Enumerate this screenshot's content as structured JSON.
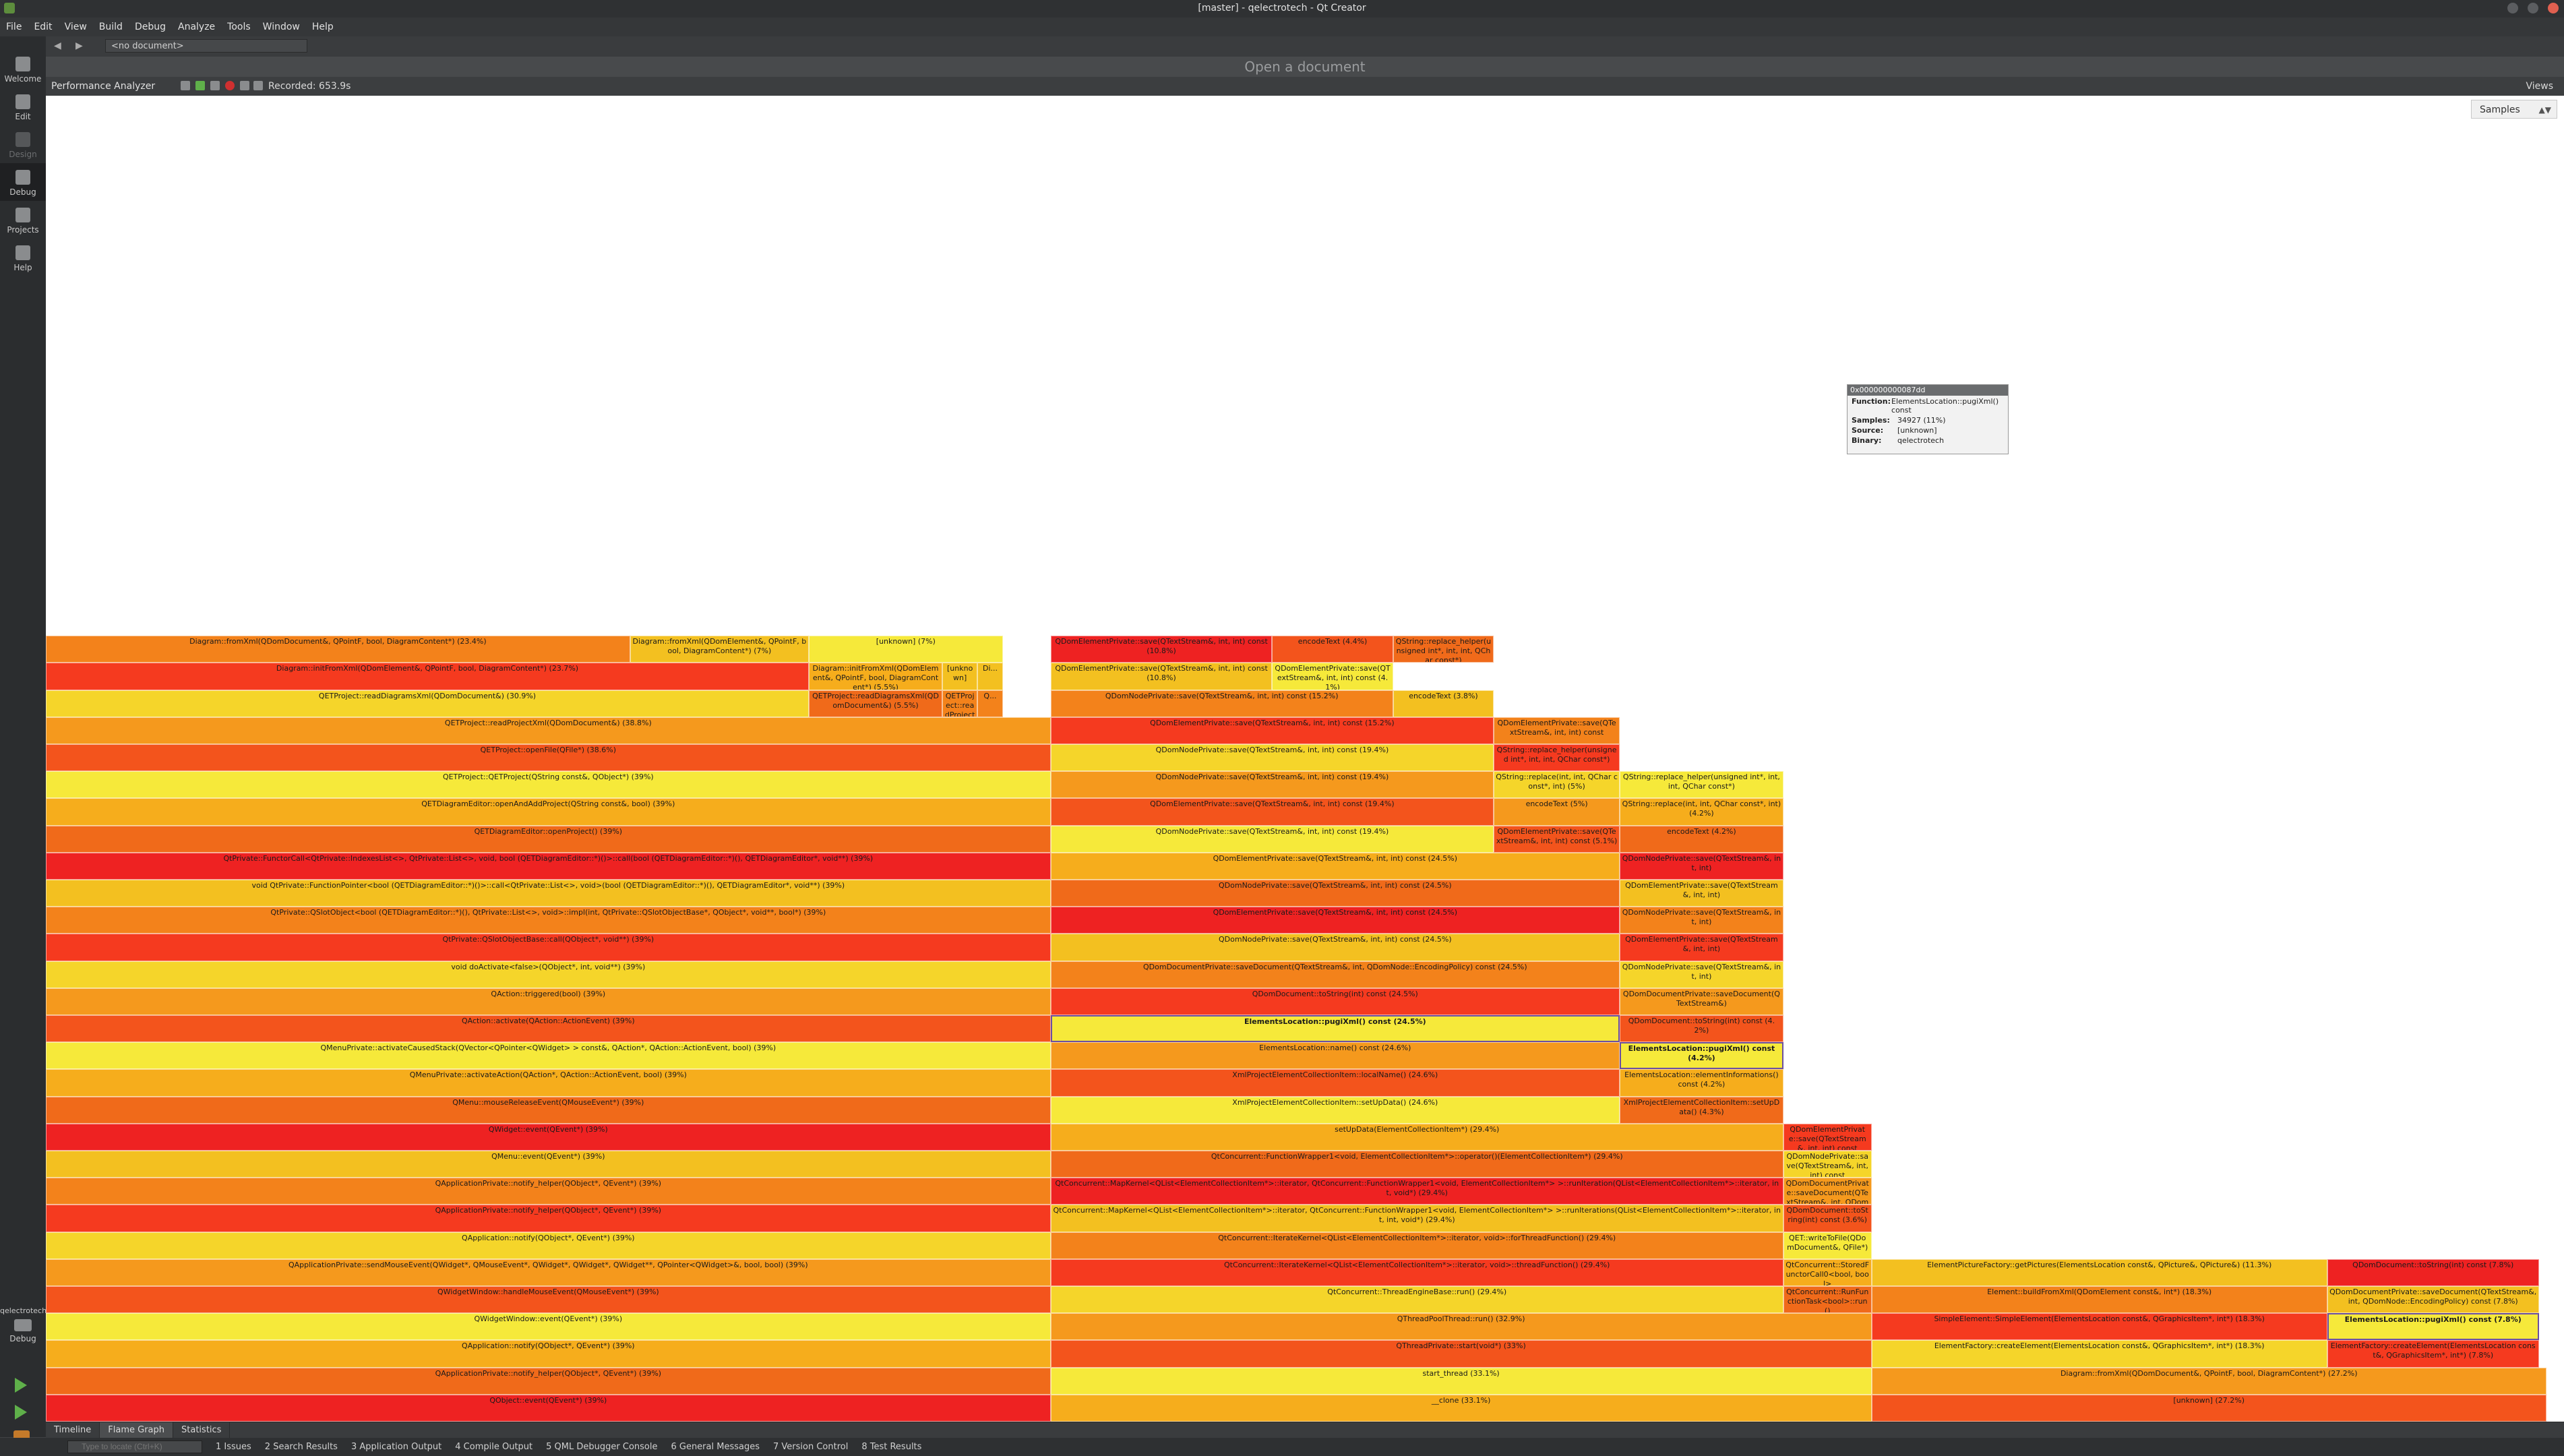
{
  "window": {
    "title": "[master] - qelectrotech - Qt Creator"
  },
  "menu": [
    "File",
    "Edit",
    "View",
    "Build",
    "Debug",
    "Analyze",
    "Tools",
    "Window",
    "Help"
  ],
  "modes": [
    {
      "label": "Welcome",
      "icon": "grid-icon"
    },
    {
      "label": "Edit",
      "icon": "document-icon"
    },
    {
      "label": "Design",
      "icon": "pen-icon"
    },
    {
      "label": "Debug",
      "icon": "bug-icon"
    },
    {
      "label": "Projects",
      "icon": "wrench-icon"
    },
    {
      "label": "Help",
      "icon": "question-icon"
    }
  ],
  "kit": {
    "label": "qelectrotech",
    "sub": "Debug"
  },
  "editor": {
    "doc_select": "<no document>",
    "open_doc": "Open a document"
  },
  "analyzer": {
    "label": "Performance Analyzer",
    "recorded": "Recorded: 653.9s",
    "views": "Views"
  },
  "sort": {
    "value": "Samples"
  },
  "tooltip": {
    "header": "0x000000000087dd",
    "rows": [
      {
        "k": "Function:",
        "v": "ElementsLocation::pugiXml() const"
      },
      {
        "k": "Samples:",
        "v": "34927 (11%)"
      },
      {
        "k": "Source:",
        "v": "[unknown]"
      },
      {
        "k": "Binary:",
        "v": "qelectrotech"
      }
    ]
  },
  "flame": [
    {
      "c": 0,
      "s": 0,
      "e": 0.399,
      "t": "QObject::event(QEvent*) (39%)"
    },
    {
      "c": 0,
      "s": 0.399,
      "e": 0.725,
      "t": "__clone (33.1%)"
    },
    {
      "c": 0,
      "s": 0.725,
      "e": 0.993,
      "t": "[unknown] (27.2%)"
    },
    {
      "c": 1,
      "s": 0,
      "e": 0.399,
      "t": "QApplicationPrivate::notify_helper(QObject*, QEvent*) (39%)"
    },
    {
      "c": 1,
      "s": 0.399,
      "e": 0.725,
      "t": "start_thread (33.1%)"
    },
    {
      "c": 1,
      "s": 0.725,
      "e": 0.993,
      "t": "Diagram::fromXml(QDomDocument&, QPointF, bool, DiagramContent*) (27.2%)"
    },
    {
      "c": 2,
      "s": 0,
      "e": 0.399,
      "t": "QApplication::notify(QObject*, QEvent*) (39%)"
    },
    {
      "c": 2,
      "s": 0.399,
      "e": 0.725,
      "t": "QThreadPrivate::start(void*) (33%)"
    },
    {
      "c": 2,
      "s": 0.725,
      "e": 0.906,
      "t": "ElementFactory::createElement(ElementsLocation const&, QGraphicsItem*, int*) (18.3%)"
    },
    {
      "c": 2,
      "s": 0.906,
      "e": 0.99,
      "t": "ElementFactory::createElement(ElementsLocation const&, QGraphicsItem*, int*) (7.8%)"
    },
    {
      "c": 3,
      "s": 0,
      "e": 0.399,
      "t": "QWidgetWindow::event(QEvent*) (39%)"
    },
    {
      "c": 3,
      "s": 0.399,
      "e": 0.725,
      "t": "QThreadPoolThread::run() (32.9%)"
    },
    {
      "c": 3,
      "s": 0.725,
      "e": 0.906,
      "t": "SimpleElement::SimpleElement(ElementsLocation const&, QGraphicsItem*, int*) (18.3%)"
    },
    {
      "c": 3,
      "s": 0.906,
      "e": 0.99,
      "t": "ElementsLocation::pugiXml() const (7.8%)",
      "hi": 1
    },
    {
      "c": 4,
      "s": 0,
      "e": 0.399,
      "t": "QWidgetWindow::handleMouseEvent(QMouseEvent*) (39%)"
    },
    {
      "c": 4,
      "s": 0.399,
      "e": 0.69,
      "t": "QtConcurrent::ThreadEngineBase::run() (29.4%)"
    },
    {
      "c": 4,
      "s": 0.69,
      "e": 0.725,
      "t": "QtConcurrent::RunFunctionTask<bool>::run()"
    },
    {
      "c": 4,
      "s": 0.725,
      "e": 0.906,
      "t": "Element::buildFromXml(QDomElement const&, int*) (18.3%)"
    },
    {
      "c": 4,
      "s": 0.906,
      "e": 0.99,
      "t": "QDomDocumentPrivate::saveDocument(QTextStream&, int, QDomNode::EncodingPolicy) const (7.8%)"
    },
    {
      "c": 5,
      "s": 0,
      "e": 0.399,
      "t": "QApplicationPrivate::sendMouseEvent(QWidget*, QMouseEvent*, QWidget*, QWidget*, QWidget**, QPointer<QWidget>&, bool, bool) (39%)"
    },
    {
      "c": 5,
      "s": 0.399,
      "e": 0.69,
      "t": "QtConcurrent::IterateKernel<QList<ElementCollectionItem*>::iterator, void>::threadFunction() (29.4%)"
    },
    {
      "c": 5,
      "s": 0.69,
      "e": 0.725,
      "t": "QtConcurrent::StoredFunctorCall0<bool, bool>"
    },
    {
      "c": 5,
      "s": 0.725,
      "e": 0.906,
      "t": "ElementPictureFactory::getPictures(ElementsLocation const&, QPicture&, QPicture&) (11.3%)"
    },
    {
      "c": 5,
      "s": 0.906,
      "e": 0.99,
      "t": "QDomDocument::toString(int) const (7.8%)"
    },
    {
      "c": 6,
      "s": 0,
      "e": 0.399,
      "t": "QApplication::notify(QObject*, QEvent*) (39%)"
    },
    {
      "c": 6,
      "s": 0.399,
      "e": 0.69,
      "t": "QtConcurrent::IterateKernel<QList<ElementCollectionItem*>::iterator, void>::forThreadFunction() (29.4%)"
    },
    {
      "c": 6,
      "s": 0.69,
      "e": 0.725,
      "t": "QET::writeToFile(QDomDocument&, QFile*)"
    },
    {
      "c": 7,
      "s": 0,
      "e": 0.399,
      "t": "QApplicationPrivate::notify_helper(QObject*, QEvent*) (39%)"
    },
    {
      "c": 7,
      "s": 0.399,
      "e": 0.69,
      "t": "QtConcurrent::MapKernel<QList<ElementCollectionItem*>::iterator, QtConcurrent::FunctionWrapper1<void, ElementCollectionItem*> >::runIterations(QList<ElementCollectionItem*>::iterator, int, int, void*) (29.4%)"
    },
    {
      "c": 7,
      "s": 0.69,
      "e": 0.725,
      "t": "QDomDocument::toString(int) const (3.6%)"
    },
    {
      "c": 8,
      "s": 0,
      "e": 0.399,
      "t": "QApplicationPrivate::notify_helper(QObject*, QEvent*) (39%)"
    },
    {
      "c": 8,
      "s": 0.399,
      "e": 0.69,
      "t": "QtConcurrent::MapKernel<QList<ElementCollectionItem*>::iterator, QtConcurrent::FunctionWrapper1<void, ElementCollectionItem*> >::runIteration(QList<ElementCollectionItem*>::iterator, int, void*) (29.4%)"
    },
    {
      "c": 8,
      "s": 0.69,
      "e": 0.725,
      "t": "QDomDocumentPrivate::saveDocument(QTextStream&, int, QDomNode)"
    },
    {
      "c": 9,
      "s": 0,
      "e": 0.399,
      "t": "QMenu::event(QEvent*) (39%)"
    },
    {
      "c": 9,
      "s": 0.399,
      "e": 0.69,
      "t": "QtConcurrent::FunctionWrapper1<void, ElementCollectionItem*>::operator()(ElementCollectionItem*) (29.4%)"
    },
    {
      "c": 9,
      "s": 0.69,
      "e": 0.725,
      "t": "QDomNodePrivate::save(QTextStream&, int, int) const"
    },
    {
      "c": 10,
      "s": 0,
      "e": 0.399,
      "t": "QWidget::event(QEvent*) (39%)"
    },
    {
      "c": 10,
      "s": 0.399,
      "e": 0.69,
      "t": "setUpData(ElementCollectionItem*) (29.4%)"
    },
    {
      "c": 10,
      "s": 0.69,
      "e": 0.725,
      "t": "QDomElementPrivate::save(QTextStream&, int, int) const"
    },
    {
      "c": 11,
      "s": 0,
      "e": 0.399,
      "t": "QMenu::mouseReleaseEvent(QMouseEvent*) (39%)"
    },
    {
      "c": 11,
      "s": 0.399,
      "e": 0.625,
      "t": "XmlProjectElementCollectionItem::setUpData() (24.6%)"
    },
    {
      "c": 11,
      "s": 0.625,
      "e": 0.69,
      "t": "XmlProjectElementCollectionItem::setUpData() (4.3%)"
    },
    {
      "c": 12,
      "s": 0,
      "e": 0.399,
      "t": "QMenuPrivate::activateAction(QAction*, QAction::ActionEvent, bool) (39%)"
    },
    {
      "c": 12,
      "s": 0.399,
      "e": 0.625,
      "t": "XmlProjectElementCollectionItem::localName() (24.6%)"
    },
    {
      "c": 12,
      "s": 0.625,
      "e": 0.69,
      "t": "ElementsLocation::elementInformations() const (4.2%)"
    },
    {
      "c": 13,
      "s": 0,
      "e": 0.399,
      "t": "QMenuPrivate::activateCausedStack(QVector<QPointer<QWidget> > const&, QAction*, QAction::ActionEvent, bool) (39%)"
    },
    {
      "c": 13,
      "s": 0.399,
      "e": 0.625,
      "t": "ElementsLocation::name() const (24.6%)"
    },
    {
      "c": 13,
      "s": 0.625,
      "e": 0.69,
      "t": "ElementsLocation::pugiXml() const (4.2%)",
      "hi": 1
    },
    {
      "c": 14,
      "s": 0,
      "e": 0.399,
      "t": "QAction::activate(QAction::ActionEvent) (39%)"
    },
    {
      "c": 14,
      "s": 0.399,
      "e": 0.625,
      "t": "ElementsLocation::pugiXml() const (24.5%)",
      "hi": 1
    },
    {
      "c": 14,
      "s": 0.625,
      "e": 0.69,
      "t": "QDomDocument::toString(int) const (4.2%)"
    },
    {
      "c": 15,
      "s": 0,
      "e": 0.399,
      "t": "QAction::triggered(bool) (39%)"
    },
    {
      "c": 15,
      "s": 0.399,
      "e": 0.625,
      "t": "QDomDocument::toString(int) const (24.5%)"
    },
    {
      "c": 15,
      "s": 0.625,
      "e": 0.69,
      "t": "QDomDocumentPrivate::saveDocument(QTextStream&)"
    },
    {
      "c": 16,
      "s": 0,
      "e": 0.399,
      "t": "void doActivate<false>(QObject*, int, void**) (39%)"
    },
    {
      "c": 16,
      "s": 0.399,
      "e": 0.625,
      "t": "QDomDocumentPrivate::saveDocument(QTextStream&, int, QDomNode::EncodingPolicy) const (24.5%)"
    },
    {
      "c": 16,
      "s": 0.625,
      "e": 0.69,
      "t": "QDomNodePrivate::save(QTextStream&, int, int)"
    },
    {
      "c": 17,
      "s": 0,
      "e": 0.399,
      "t": "QtPrivate::QSlotObjectBase::call(QObject*, void**) (39%)"
    },
    {
      "c": 17,
      "s": 0.399,
      "e": 0.625,
      "t": "QDomNodePrivate::save(QTextStream&, int, int) const (24.5%)"
    },
    {
      "c": 17,
      "s": 0.625,
      "e": 0.69,
      "t": "QDomElementPrivate::save(QTextStream&, int, int)"
    },
    {
      "c": 18,
      "s": 0,
      "e": 0.399,
      "t": "QtPrivate::QSlotObject<bool (QETDiagramEditor::*)(), QtPrivate::List<>, void>::impl(int, QtPrivate::QSlotObjectBase*, QObject*, void**, bool*) (39%)"
    },
    {
      "c": 18,
      "s": 0.399,
      "e": 0.625,
      "t": "QDomElementPrivate::save(QTextStream&, int, int) const (24.5%)"
    },
    {
      "c": 18,
      "s": 0.625,
      "e": 0.69,
      "t": "QDomNodePrivate::save(QTextStream&, int, int)"
    },
    {
      "c": 19,
      "s": 0,
      "e": 0.399,
      "t": "void QtPrivate::FunctionPointer<bool (QETDiagramEditor::*)()>::call<QtPrivate::List<>, void>(bool (QETDiagramEditor::*)(), QETDiagramEditor*, void**) (39%)"
    },
    {
      "c": 19,
      "s": 0.399,
      "e": 0.625,
      "t": "QDomNodePrivate::save(QTextStream&, int, int) const (24.5%)"
    },
    {
      "c": 19,
      "s": 0.625,
      "e": 0.69,
      "t": "QDomElementPrivate::save(QTextStream&, int, int)"
    },
    {
      "c": 20,
      "s": 0,
      "e": 0.399,
      "t": "QtPrivate::FunctorCall<QtPrivate::IndexesList<>, QtPrivate::List<>, void, bool (QETDiagramEditor::*)()>::call(bool (QETDiagramEditor::*)(), QETDiagramEditor*, void**) (39%)"
    },
    {
      "c": 20,
      "s": 0.399,
      "e": 0.625,
      "t": "QDomElementPrivate::save(QTextStream&, int, int) const (24.5%)"
    },
    {
      "c": 20,
      "s": 0.625,
      "e": 0.69,
      "t": "QDomNodePrivate::save(QTextStream&, int, int)"
    },
    {
      "c": 21,
      "s": 0,
      "e": 0.399,
      "t": "QETDiagramEditor::openProject() (39%)"
    },
    {
      "c": 21,
      "s": 0.399,
      "e": 0.575,
      "t": "QDomNodePrivate::save(QTextStream&, int, int) const (19.4%)"
    },
    {
      "c": 21,
      "s": 0.575,
      "e": 0.625,
      "t": "QDomElementPrivate::save(QTextStream&, int, int) const (5.1%)"
    },
    {
      "c": 21,
      "s": 0.625,
      "e": 0.69,
      "t": "encodeText (4.2%)"
    },
    {
      "c": 22,
      "s": 0,
      "e": 0.399,
      "t": "QETDiagramEditor::openAndAddProject(QString const&, bool) (39%)"
    },
    {
      "c": 22,
      "s": 0.399,
      "e": 0.575,
      "t": "QDomElementPrivate::save(QTextStream&, int, int) const (19.4%)"
    },
    {
      "c": 22,
      "s": 0.575,
      "e": 0.625,
      "t": "encodeText (5%)"
    },
    {
      "c": 22,
      "s": 0.625,
      "e": 0.69,
      "t": "QString::replace(int, int, QChar const*, int) (4.2%)"
    },
    {
      "c": 23,
      "s": 0,
      "e": 0.399,
      "t": "QETProject::QETProject(QString const&, QObject*) (39%)"
    },
    {
      "c": 23,
      "s": 0.399,
      "e": 0.575,
      "t": "QDomNodePrivate::save(QTextStream&, int, int) const (19.4%)"
    },
    {
      "c": 23,
      "s": 0.575,
      "e": 0.625,
      "t": "QString::replace(int, int, QChar const*, int) (5%)"
    },
    {
      "c": 23,
      "s": 0.625,
      "e": 0.69,
      "t": "QString::replace_helper(unsigned int*, int, int, QChar const*)"
    },
    {
      "c": 24,
      "s": 0,
      "e": 0.399,
      "t": "QETProject::openFile(QFile*) (38.6%)"
    },
    {
      "c": 24,
      "s": 0.399,
      "e": 0.575,
      "t": "QDomNodePrivate::save(QTextStream&, int, int) const (19.4%)"
    },
    {
      "c": 24,
      "s": 0.575,
      "e": 0.625,
      "t": "QString::replace_helper(unsigned int*, int, int, QChar const*)"
    },
    {
      "c": 25,
      "s": 0,
      "e": 0.399,
      "t": "QETProject::readProjectXml(QDomDocument&) (38.8%)"
    },
    {
      "c": 25,
      "s": 0.399,
      "e": 0.575,
      "t": "QDomElementPrivate::save(QTextStream&, int, int) const (15.2%)"
    },
    {
      "c": 25,
      "s": 0.575,
      "e": 0.625,
      "t": "QDomElementPrivate::save(QTextStream&, int, int) const"
    },
    {
      "c": 26,
      "s": 0,
      "e": 0.303,
      "t": "QETProject::readDiagramsXml(QDomDocument&) (30.9%)"
    },
    {
      "c": 26,
      "s": 0.303,
      "e": 0.356,
      "t": "QETProject::readDiagramsXml(QDomDocument&) (5.5%)"
    },
    {
      "c": 26,
      "s": 0.356,
      "e": 0.37,
      "t": "QETProject::readProjectXml"
    },
    {
      "c": 26,
      "s": 0.37,
      "e": 0.38,
      "t": "Q..."
    },
    {
      "c": 26,
      "s": 0.399,
      "e": 0.535,
      "t": "QDomNodePrivate::save(QTextStream&, int, int) const (15.2%)"
    },
    {
      "c": 26,
      "s": 0.535,
      "e": 0.575,
      "t": "encodeText (3.8%)"
    },
    {
      "c": 27,
      "s": 0,
      "e": 0.303,
      "t": "Diagram::initFromXml(QDomElement&, QPointF, bool, DiagramContent*) (23.7%)"
    },
    {
      "c": 27,
      "s": 0.303,
      "e": 0.356,
      "t": "Diagram::initFromXml(QDomElement&, QPointF, bool, DiagramContent*) (5.5%)"
    },
    {
      "c": 27,
      "s": 0.356,
      "e": 0.37,
      "t": "[unknown]"
    },
    {
      "c": 27,
      "s": 0.37,
      "e": 0.38,
      "t": "Di..."
    },
    {
      "c": 27,
      "s": 0.399,
      "e": 0.487,
      "t": "QDomElementPrivate::save(QTextStream&, int, int) const (10.8%)"
    },
    {
      "c": 27,
      "s": 0.487,
      "e": 0.535,
      "t": "QDomElementPrivate::save(QTextStream&, int, int) const (4.1%)"
    },
    {
      "c": 28,
      "s": 0,
      "e": 0.232,
      "t": "Diagram::fromXml(QDomDocument&, QPointF, bool, DiagramContent*) (23.4%)"
    },
    {
      "c": 28,
      "s": 0.232,
      "e": 0.303,
      "t": "Diagram::fromXml(QDomElement&, QPointF, bool, DiagramContent*) (7%)"
    },
    {
      "c": 28,
      "s": 0.303,
      "e": 0.38,
      "t": "[unknown] (7%)"
    },
    {
      "c": 28,
      "s": 0.399,
      "e": 0.487,
      "t": "QDomElementPrivate::save(QTextStream&, int, int) const (10.8%)"
    },
    {
      "c": 28,
      "s": 0.487,
      "e": 0.535,
      "t": "encodeText (4.4%)"
    },
    {
      "c": 28,
      "s": 0.535,
      "e": 0.575,
      "t": "QString::replace_helper(unsigned int*, int, int, QChar const*)"
    }
  ],
  "bottom_tabs": [
    "Timeline",
    "Flame Graph",
    "Statistics"
  ],
  "status": {
    "locate_placeholder": "Type to locate (Ctrl+K)",
    "outputs": [
      "1 Issues",
      "2 Search Results",
      "3 Application Output",
      "4 Compile Output",
      "5 QML Debugger Console",
      "6 General Messages",
      "7 Version Control",
      "8 Test Results"
    ]
  },
  "colors": {
    "heat": [
      "#ee2222",
      "#f53a1f",
      "#f3541c",
      "#f06a1a",
      "#f3821b",
      "#f5991d",
      "#f6ad1c",
      "#f3c020",
      "#f5d52a",
      "#f6e93a"
    ]
  }
}
